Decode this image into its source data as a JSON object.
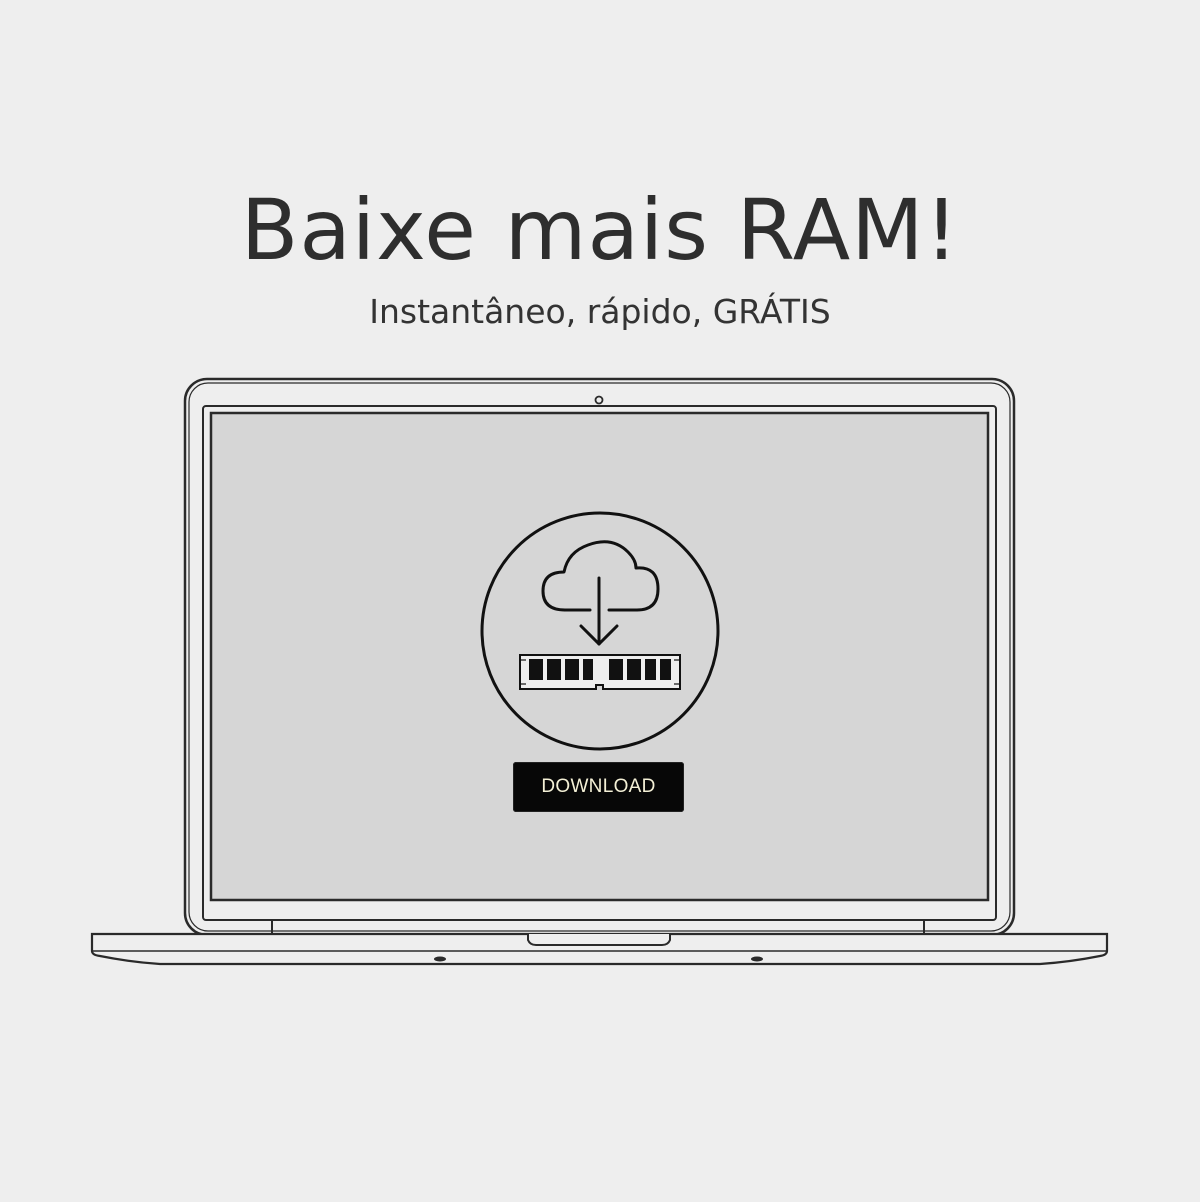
{
  "headline": "Baixe mais RAM!",
  "subline": "Instantâneo, rápido, GRÁTIS",
  "screen": {
    "download_button_label": "DOWNLOAD",
    "icon": "cloud-download-ram-icon"
  },
  "colors": {
    "background": "#eeeeee",
    "screen": "#d6d6d6",
    "outline": "#2a2a2a",
    "button_bg": "#070707",
    "button_text": "#f4f0d6"
  }
}
